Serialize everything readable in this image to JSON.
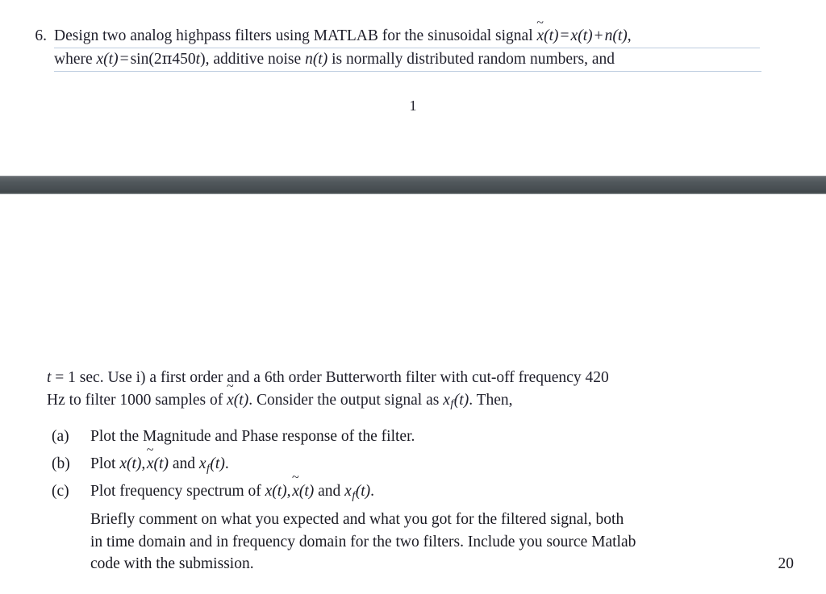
{
  "document": {
    "type": "assignment-question-page",
    "background_color": "#ffffff",
    "text_color": "#20202c"
  },
  "page_one": {
    "question": {
      "number": "6.",
      "line1_prefix": "Design two analog highpass filters using MATLAB for the sinusoidal signal ",
      "line1_math": "x̃(t) = x(t)+n(t),",
      "line2_prefix": "where ",
      "line2_math": "x(t) = sin(2π450t),",
      "line2_mid": " additive noise ",
      "line2_math2": "n(t)",
      "line2_suffix": " is normally distributed random numbers, and",
      "underline_color": "#b9cade"
    },
    "page_number": "1"
  },
  "separator": {
    "name": "page-break-band",
    "color": "#474d51",
    "highlight_color": "#8d9296"
  },
  "page_two": {
    "continuation": {
      "line1": "t = 1 sec.  Use i) a first order and a 6th order Butterworth filter with cut-off frequency 420",
      "line1_math_t": "t",
      "line1_eq": " = 1 sec.  Use i) a first order and a 6th order Butterworth filter with cut-off frequency 420",
      "line2_a": "Hz to filter 1000 samples of ",
      "line2_math1": "x̃(t)",
      "line2_b": ". Consider the output signal as ",
      "line2_math2": "x",
      "line2_sub": "f",
      "line2_c": "(t)",
      "line2_d": ". Then,"
    },
    "items": [
      {
        "label": "(a)",
        "text": "Plot the Magnitude and Phase response of the filter."
      },
      {
        "label": "(b)",
        "text_prefix": "Plot ",
        "math": "x(t), x̃(t) and x_f(t)."
      },
      {
        "label": "(c)",
        "text_prefix": "Plot frequency spectrum of ",
        "math": "x(t), x̃(t) and x_f(t).",
        "paragraph": {
          "line1": "Briefly comment on what you expected and what you got for the filtered signal, both",
          "line2": "in time domain and in frequency domain for the two filters. Include you source Matlab",
          "line3": "code with the submission."
        }
      }
    ],
    "marks": "20"
  }
}
